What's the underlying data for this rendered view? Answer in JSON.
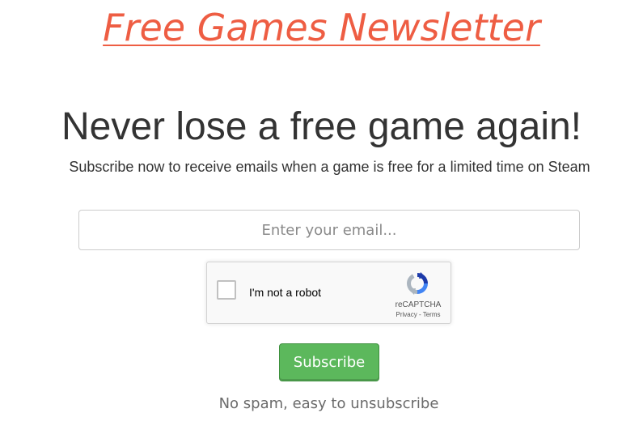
{
  "header": {
    "brand_link": "Free Games Newsletter"
  },
  "hero": {
    "headline": "Never lose a free game again!",
    "subtitle": "Subscribe now to receive emails when a game is free for a limited time on Steam"
  },
  "form": {
    "email_placeholder": "Enter your email...",
    "email_value": "",
    "recaptcha": {
      "checkbox_label": "I'm not a robot",
      "brand": "reCAPTCHA",
      "privacy_link": "Privacy",
      "separator": " - ",
      "terms_link": "Terms",
      "logo_icon": "recaptcha-logo-icon",
      "checked": false
    },
    "subscribe_label": "Subscribe",
    "footnote": "No spam, easy to unsubscribe"
  },
  "colors": {
    "brand": "#ee5d43",
    "subscribe_button": "#5cb85c",
    "text": "#333333",
    "muted_text": "#6b6b6b"
  }
}
